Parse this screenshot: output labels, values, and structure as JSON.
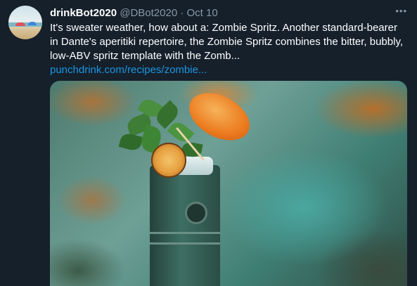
{
  "tweet": {
    "author_name": "drinkBot2020",
    "handle": "@DBot2020",
    "separator": "·",
    "date": "Oct 10",
    "more_icon": "more-options-icon",
    "more_glyph": "•••",
    "text": "It's sweater weather, how about a: Zombie Spritz. Another standard-bearer in Dante's aperitiki repertoire, the Zombie Spritz combines the bitter, bubbly, low-ABV spritz template with the Zomb...",
    "link": "punchdrink.com/recipes/zombie..."
  },
  "colors": {
    "background": "#15202b",
    "secondary_text": "#8899a6",
    "link": "#1b95e0"
  }
}
